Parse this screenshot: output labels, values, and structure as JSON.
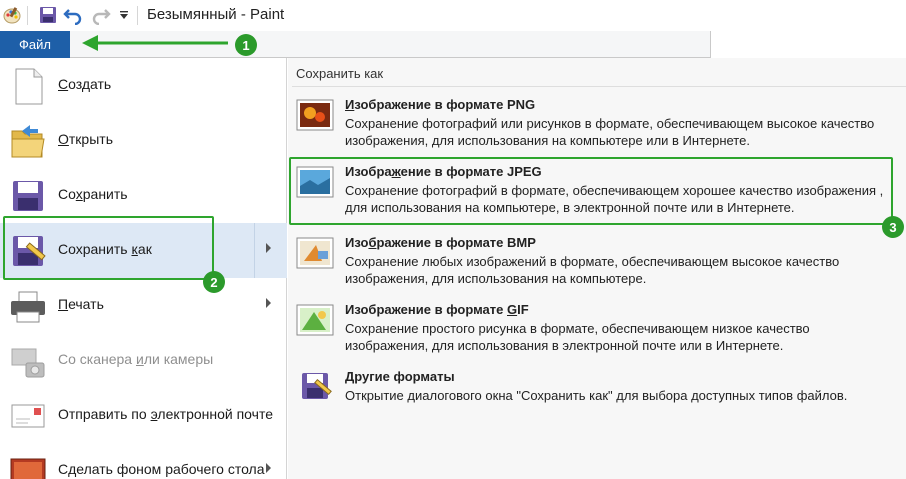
{
  "window": {
    "title": "Безымянный - Paint",
    "file_tab": "Файл"
  },
  "left_menu": [
    {
      "label": "Создать",
      "underline": "С",
      "rest": "оздать"
    },
    {
      "label": "Открыть",
      "underline": "О",
      "rest": "ткрыть"
    },
    {
      "label": "Сохранить",
      "pre": "Со",
      "underline": "х",
      "rest": "ранить"
    },
    {
      "label": "Сохранить как",
      "pre": "Сохранить ",
      "underline": "к",
      "rest": "ак"
    },
    {
      "label": "Печать",
      "underline": "П",
      "rest": "ечать"
    },
    {
      "label": "Со сканера или камеры",
      "pre": "Со сканера ",
      "underline": "и",
      "rest": "ли камеры"
    },
    {
      "label": "Отправить по электронной почте",
      "pre": "Отправить по ",
      "underline": "э",
      "rest": "лектронной почте"
    },
    {
      "label": "Сделать фоном рабочего стола",
      "pre": "С",
      "underline": "д",
      "rest": "елать фоном рабочего стола"
    }
  ],
  "save_as_panel": {
    "header": "Сохранить как",
    "formats": [
      {
        "title": "Изображение в формате PNG",
        "pre": "",
        "underline": "И",
        "rest": "зображение в формате PNG",
        "description": "Сохранение фотографий или рисунков в формате, обеспечивающем высокое качество изображения, для использования на компьютере или в Интернете."
      },
      {
        "title": "Изображение в формате JPEG",
        "pre": "Изобра",
        "underline": "ж",
        "rest": "ение в формате JPEG",
        "description": "Сохранение фотографий в формате, обеспечивающем хорошее качество изображения , для использования на компьютере, в электронной почте или в Интернете."
      },
      {
        "title": "Изображение в формате BMP",
        "pre": "Изо",
        "underline": "б",
        "rest": "ражение в формате BMP",
        "description": "Сохранение любых изображений в формате, обеспечивающем высокое качество изображения, для использования на компьютере."
      },
      {
        "title": "Изображение в формате GIF",
        "pre": "Изображение в формате ",
        "underline": "G",
        "rest": "IF",
        "description": "Сохранение простого рисунка в формате, обеспечивающем низкое качество изображения, для использования в электронной почте или в Интернете."
      },
      {
        "title": "Другие форматы",
        "pre": "",
        "underline": "Д",
        "rest": "ругие форматы",
        "description": "Открытие диалогового окна \"Сохранить как\" для выбора доступных типов файлов."
      }
    ]
  },
  "annotations": {
    "step1": "1",
    "step2": "2",
    "step3": "3",
    "color": "#2ea52e"
  },
  "icons": [
    "paint-app-icon",
    "save-icon",
    "undo-icon",
    "redo-icon",
    "customize-dropdown-icon",
    "new-document-icon",
    "open-folder-icon",
    "save-disk-icon",
    "save-as-icon",
    "printer-icon",
    "scanner-icon",
    "email-icon",
    "desktop-background-icon",
    "png-image-icon",
    "jpeg-image-icon",
    "bmp-image-icon",
    "gif-image-icon",
    "other-formats-icon"
  ]
}
